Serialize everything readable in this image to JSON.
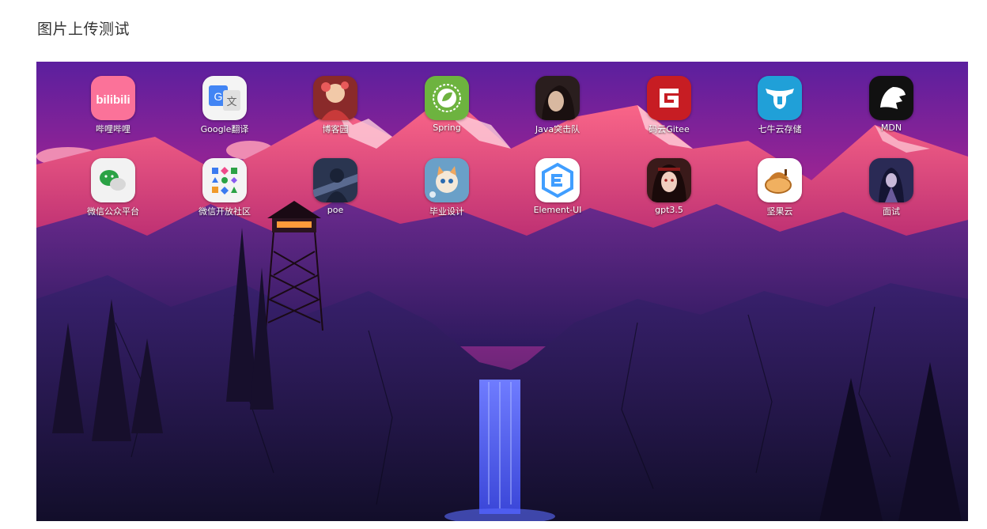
{
  "page": {
    "title": "图片上传测试"
  },
  "apps": [
    {
      "label": "哔哩哔哩",
      "icon": "bilibili-icon",
      "color": "#fb7299"
    },
    {
      "label": "Google翻译",
      "icon": "google-translate-icon",
      "color": "#4285f4"
    },
    {
      "label": "博客园",
      "icon": "cnblogs-avatar-icon",
      "color": "#b83a3a"
    },
    {
      "label": "Spring",
      "icon": "spring-icon",
      "color": "#6db33f"
    },
    {
      "label": "Java突击队",
      "icon": "java-team-avatar-icon",
      "color": "#3a2a2a"
    },
    {
      "label": "码云Gitee",
      "icon": "gitee-icon",
      "color": "#c71d23"
    },
    {
      "label": "七牛云存储",
      "icon": "qiniu-icon",
      "color": "#20a0d8"
    },
    {
      "label": "MDN",
      "icon": "mdn-icon",
      "color": "#111111"
    },
    {
      "label": "微信公众平台",
      "icon": "wechat-icon",
      "color": "#2ba245"
    },
    {
      "label": "微信开放社区",
      "icon": "wechat-open-community-icon",
      "color": "#f0f0f0"
    },
    {
      "label": "poe",
      "icon": "poe-avatar-icon",
      "color": "#3a4a66"
    },
    {
      "label": "毕业设计",
      "icon": "graduation-cat-icon",
      "color": "#6aa0c8"
    },
    {
      "label": "Element-UI",
      "icon": "element-ui-icon",
      "color": "#409eff"
    },
    {
      "label": "gpt3.5",
      "icon": "gpt-avatar-icon",
      "color": "#6a2a2a"
    },
    {
      "label": "坚果云",
      "icon": "jianguoyun-icon",
      "color": "#d98a2b"
    },
    {
      "label": "面试",
      "icon": "interview-avatar-icon",
      "color": "#2a2a55"
    }
  ]
}
